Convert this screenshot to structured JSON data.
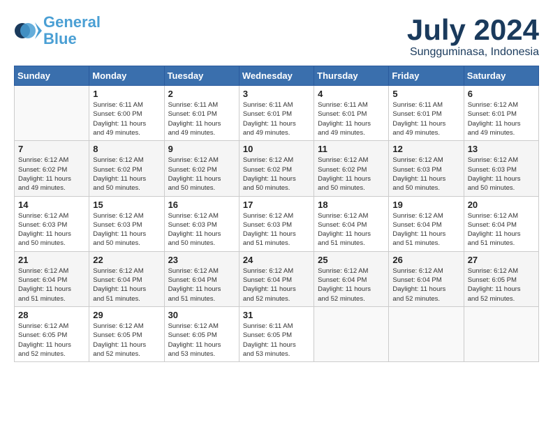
{
  "header": {
    "logo_line1": "General",
    "logo_line2": "Blue",
    "month_year": "July 2024",
    "location": "Sungguminasa, Indonesia"
  },
  "days_of_week": [
    "Sunday",
    "Monday",
    "Tuesday",
    "Wednesday",
    "Thursday",
    "Friday",
    "Saturday"
  ],
  "weeks": [
    [
      {
        "day": "",
        "info": ""
      },
      {
        "day": "1",
        "info": "Sunrise: 6:11 AM\nSunset: 6:00 PM\nDaylight: 11 hours\nand 49 minutes."
      },
      {
        "day": "2",
        "info": "Sunrise: 6:11 AM\nSunset: 6:01 PM\nDaylight: 11 hours\nand 49 minutes."
      },
      {
        "day": "3",
        "info": "Sunrise: 6:11 AM\nSunset: 6:01 PM\nDaylight: 11 hours\nand 49 minutes."
      },
      {
        "day": "4",
        "info": "Sunrise: 6:11 AM\nSunset: 6:01 PM\nDaylight: 11 hours\nand 49 minutes."
      },
      {
        "day": "5",
        "info": "Sunrise: 6:11 AM\nSunset: 6:01 PM\nDaylight: 11 hours\nand 49 minutes."
      },
      {
        "day": "6",
        "info": "Sunrise: 6:12 AM\nSunset: 6:01 PM\nDaylight: 11 hours\nand 49 minutes."
      }
    ],
    [
      {
        "day": "7",
        "info": "Sunrise: 6:12 AM\nSunset: 6:02 PM\nDaylight: 11 hours\nand 49 minutes."
      },
      {
        "day": "8",
        "info": "Sunrise: 6:12 AM\nSunset: 6:02 PM\nDaylight: 11 hours\nand 50 minutes."
      },
      {
        "day": "9",
        "info": "Sunrise: 6:12 AM\nSunset: 6:02 PM\nDaylight: 11 hours\nand 50 minutes."
      },
      {
        "day": "10",
        "info": "Sunrise: 6:12 AM\nSunset: 6:02 PM\nDaylight: 11 hours\nand 50 minutes."
      },
      {
        "day": "11",
        "info": "Sunrise: 6:12 AM\nSunset: 6:02 PM\nDaylight: 11 hours\nand 50 minutes."
      },
      {
        "day": "12",
        "info": "Sunrise: 6:12 AM\nSunset: 6:03 PM\nDaylight: 11 hours\nand 50 minutes."
      },
      {
        "day": "13",
        "info": "Sunrise: 6:12 AM\nSunset: 6:03 PM\nDaylight: 11 hours\nand 50 minutes."
      }
    ],
    [
      {
        "day": "14",
        "info": "Sunrise: 6:12 AM\nSunset: 6:03 PM\nDaylight: 11 hours\nand 50 minutes."
      },
      {
        "day": "15",
        "info": "Sunrise: 6:12 AM\nSunset: 6:03 PM\nDaylight: 11 hours\nand 50 minutes."
      },
      {
        "day": "16",
        "info": "Sunrise: 6:12 AM\nSunset: 6:03 PM\nDaylight: 11 hours\nand 50 minutes."
      },
      {
        "day": "17",
        "info": "Sunrise: 6:12 AM\nSunset: 6:03 PM\nDaylight: 11 hours\nand 51 minutes."
      },
      {
        "day": "18",
        "info": "Sunrise: 6:12 AM\nSunset: 6:04 PM\nDaylight: 11 hours\nand 51 minutes."
      },
      {
        "day": "19",
        "info": "Sunrise: 6:12 AM\nSunset: 6:04 PM\nDaylight: 11 hours\nand 51 minutes."
      },
      {
        "day": "20",
        "info": "Sunrise: 6:12 AM\nSunset: 6:04 PM\nDaylight: 11 hours\nand 51 minutes."
      }
    ],
    [
      {
        "day": "21",
        "info": "Sunrise: 6:12 AM\nSunset: 6:04 PM\nDaylight: 11 hours\nand 51 minutes."
      },
      {
        "day": "22",
        "info": "Sunrise: 6:12 AM\nSunset: 6:04 PM\nDaylight: 11 hours\nand 51 minutes."
      },
      {
        "day": "23",
        "info": "Sunrise: 6:12 AM\nSunset: 6:04 PM\nDaylight: 11 hours\nand 51 minutes."
      },
      {
        "day": "24",
        "info": "Sunrise: 6:12 AM\nSunset: 6:04 PM\nDaylight: 11 hours\nand 52 minutes."
      },
      {
        "day": "25",
        "info": "Sunrise: 6:12 AM\nSunset: 6:04 PM\nDaylight: 11 hours\nand 52 minutes."
      },
      {
        "day": "26",
        "info": "Sunrise: 6:12 AM\nSunset: 6:04 PM\nDaylight: 11 hours\nand 52 minutes."
      },
      {
        "day": "27",
        "info": "Sunrise: 6:12 AM\nSunset: 6:05 PM\nDaylight: 11 hours\nand 52 minutes."
      }
    ],
    [
      {
        "day": "28",
        "info": "Sunrise: 6:12 AM\nSunset: 6:05 PM\nDaylight: 11 hours\nand 52 minutes."
      },
      {
        "day": "29",
        "info": "Sunrise: 6:12 AM\nSunset: 6:05 PM\nDaylight: 11 hours\nand 52 minutes."
      },
      {
        "day": "30",
        "info": "Sunrise: 6:12 AM\nSunset: 6:05 PM\nDaylight: 11 hours\nand 53 minutes."
      },
      {
        "day": "31",
        "info": "Sunrise: 6:11 AM\nSunset: 6:05 PM\nDaylight: 11 hours\nand 53 minutes."
      },
      {
        "day": "",
        "info": ""
      },
      {
        "day": "",
        "info": ""
      },
      {
        "day": "",
        "info": ""
      }
    ]
  ]
}
